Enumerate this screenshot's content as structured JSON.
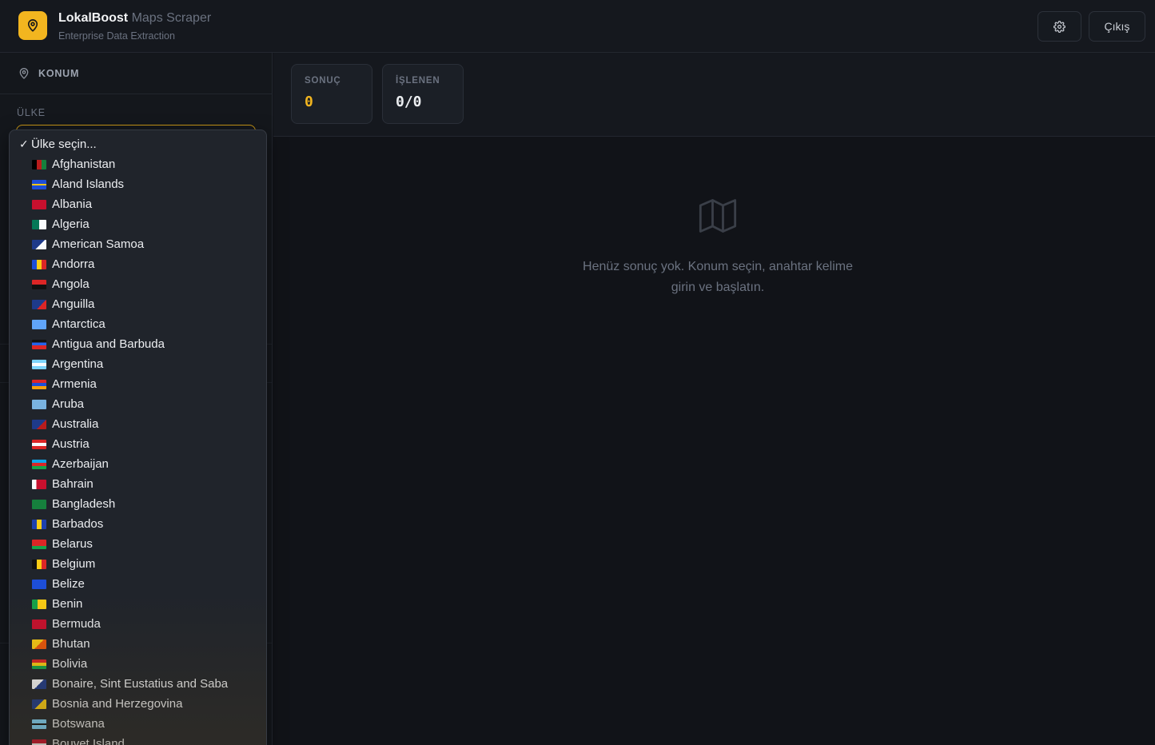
{
  "header": {
    "brand_name": "LokalBoost",
    "brand_suffix": "Maps Scraper",
    "tagline": "Enterprise Data Extraction",
    "logout_label": "Çıkış",
    "accent_color": "#f2b51f"
  },
  "sidebar": {
    "section_title": "KONUM",
    "country_label": "ÜLKE",
    "country_select": {
      "selected": "Ülke seçin...",
      "options": [
        "Afghanistan",
        "Aland Islands",
        "Albania",
        "Algeria",
        "American Samoa",
        "Andorra",
        "Angola",
        "Anguilla",
        "Antarctica",
        "Antigua and Barbuda",
        "Argentina",
        "Armenia",
        "Aruba",
        "Australia",
        "Austria",
        "Azerbaijan",
        "Bahrain",
        "Bangladesh",
        "Barbados",
        "Belarus",
        "Belgium",
        "Belize",
        "Benin",
        "Bermuda",
        "Bhutan",
        "Bolivia",
        "Bonaire, Sint Eustatius and Saba",
        "Bosnia and Herzegovina",
        "Botswana",
        "Bouvet Island"
      ]
    }
  },
  "stats": {
    "results_label": "SONUÇ",
    "results_value": "0",
    "processed_label": "İŞLENEN",
    "processed_value": "0/0"
  },
  "empty_state": {
    "line1": "Henüz sonuç yok. Konum seçin, anahtar kelime",
    "line2": "girin ve başlatın."
  }
}
